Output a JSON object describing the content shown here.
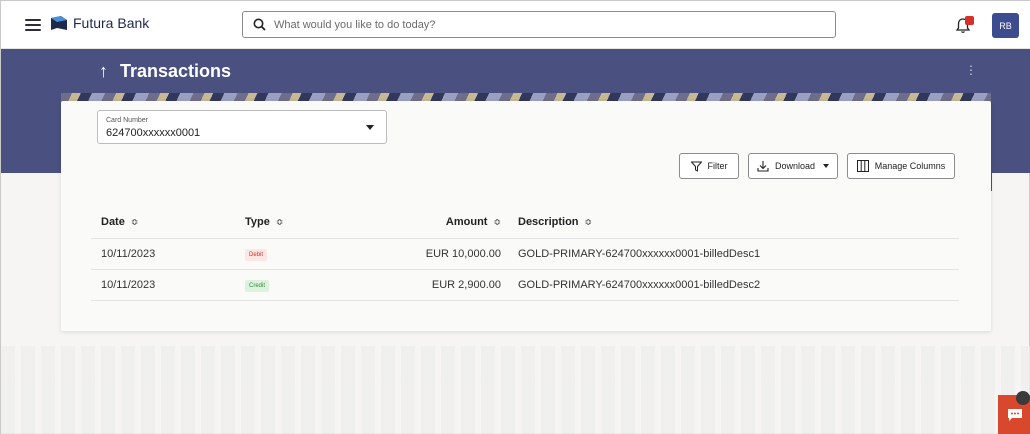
{
  "header": {
    "brand": "Futura Bank",
    "search_placeholder": "What would you like to do today?",
    "avatar_initials": "RB"
  },
  "page": {
    "title": "Transactions"
  },
  "card_select": {
    "label": "Card Number",
    "value": "624700xxxxxx0001"
  },
  "toolbar": {
    "filter_label": "Filter",
    "download_label": "Download",
    "manage_columns_label": "Manage Columns"
  },
  "table": {
    "headers": [
      "Date",
      "Type",
      "Amount",
      "Description"
    ],
    "rows": [
      {
        "date": "10/11/2023",
        "type": "Debit",
        "amount": "EUR 10,000.00",
        "description": "GOLD-PRIMARY-624700xxxxxx0001-billedDesc1"
      },
      {
        "date": "10/11/2023",
        "type": "Credit",
        "amount": "EUR 2,900.00",
        "description": "GOLD-PRIMARY-624700xxxxxx0001-billedDesc2"
      }
    ]
  },
  "colors": {
    "banner": "#4a5180",
    "accent": "#3d4b8f",
    "debit": "#c0392b",
    "credit": "#3b8a3e",
    "chat": "#d9472c"
  },
  "icons": {
    "menu": "hamburger-icon",
    "search": "search-icon",
    "notifications": "bell-icon",
    "back": "arrow-up-icon",
    "more": "kebab-icon",
    "filter": "filter-icon",
    "download": "download-icon",
    "columns": "columns-icon",
    "sort": "sort-icon",
    "chat": "chat-icon"
  }
}
